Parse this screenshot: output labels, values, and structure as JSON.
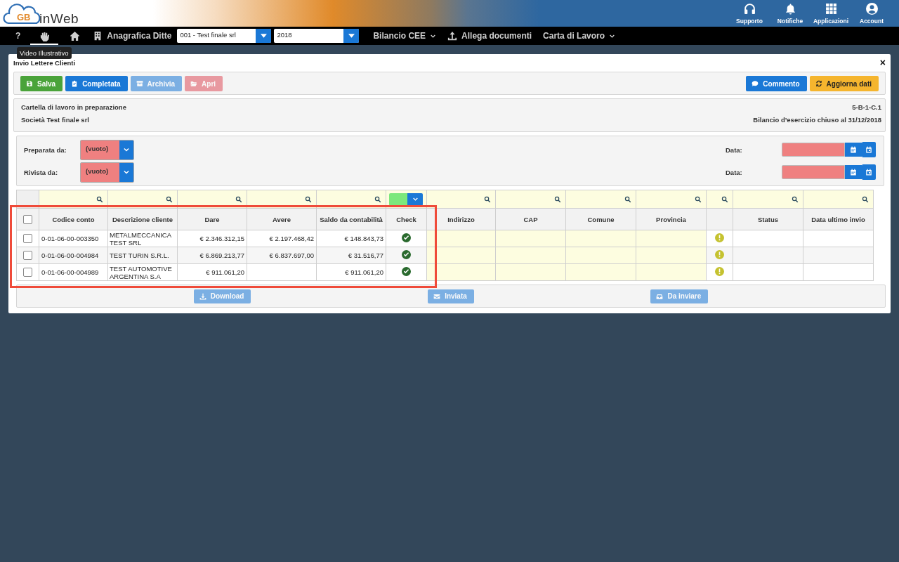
{
  "header": {
    "logo_mark": "GB",
    "logo_text": "inWeb",
    "actions": [
      {
        "kind": "support",
        "label": "Supporto"
      },
      {
        "kind": "notifications",
        "label": "Notifiche"
      },
      {
        "kind": "apps",
        "label": "Applicazioni"
      },
      {
        "kind": "account",
        "label": "Account"
      }
    ]
  },
  "nav": [
    {
      "kind": "help",
      "label": "?",
      "selected": false
    },
    {
      "kind": "video",
      "selected": true
    },
    {
      "kind": "home",
      "selected": false
    },
    {
      "kind": "company",
      "label": "Anagrafica Ditte",
      "selected": false
    },
    {
      "kind": "select",
      "value": "001 - Test finale srl"
    },
    {
      "kind": "select-small",
      "value": "2018"
    },
    {
      "kind": "menu",
      "label": "Bilancio CEE",
      "selected": false
    },
    {
      "kind": "upload",
      "label": "Allega documenti",
      "selected": false
    },
    {
      "kind": "menu",
      "label": "Carta di Lavoro",
      "selected": false
    }
  ],
  "tooltip": {
    "text": "Video Illustrativo"
  },
  "panel": {
    "title": "Invio Lettere Clienti",
    "close": "×"
  },
  "toolbar": {
    "left": [
      {
        "kind": "save",
        "label": "Salva",
        "disabled": false
      },
      {
        "kind": "complete",
        "label": "Completata",
        "disabled": false
      },
      {
        "kind": "archive",
        "label": "Archivia",
        "disabled": true
      },
      {
        "kind": "open",
        "label": "Apri",
        "disabled": true
      }
    ],
    "right": [
      {
        "kind": "comment",
        "label": "Commento",
        "disabled": false
      },
      {
        "kind": "refresh",
        "label": "Aggiorna dati",
        "disabled": false
      }
    ]
  },
  "info": {
    "left": [
      "Cartella di lavoro in preparazione",
      "Società Test finale srl"
    ],
    "right": [
      "5-B-1-C.1",
      "Bilancio d’esercizio chiuso al 31/12/2018"
    ]
  },
  "reviews": [
    {
      "label": "Preparata da:",
      "value": "(vuoto)",
      "date_label": "Data:"
    },
    {
      "label": "Rivista da:",
      "value": "(vuoto)",
      "date_label": "Data:"
    }
  ],
  "table": {
    "columns": [
      {
        "kind": "checkbox",
        "checked": false
      },
      {
        "label": "Codice conto",
        "filter": {
          "kind": "search"
        }
      },
      {
        "label": "Descrizione cliente",
        "filter": {
          "kind": "search"
        }
      },
      {
        "label": "Dare",
        "filter": {
          "kind": "search"
        }
      },
      {
        "label": "Avere",
        "filter": {
          "kind": "search"
        }
      },
      {
        "label": "Saldo da contabilità",
        "filter": {
          "kind": "search"
        }
      },
      {
        "label": "Check",
        "filter": {
          "kind": "status"
        }
      },
      {
        "label": "Indirizzo",
        "filter": {
          "kind": "search"
        }
      },
      {
        "label": "CAP",
        "filter": {
          "kind": "search"
        }
      },
      {
        "label": "Comune",
        "filter": {
          "kind": "search"
        }
      },
      {
        "label": "Provincia",
        "filter": {
          "kind": "search"
        }
      },
      {
        "filter": {
          "kind": "search"
        }
      },
      {
        "label": "Status",
        "filter": {
          "kind": "search"
        }
      },
      {
        "label": "Data ultimo invio",
        "filter": {
          "kind": "search"
        }
      }
    ],
    "rows": [
      {
        "selected": false,
        "code": "0-01-06-00-003350",
        "description": "METALMECCANICA TEST SRL",
        "dare": "€ 2.346.312,15",
        "avere": "€ 2.197.468,42",
        "saldo": "€ 148.843,73",
        "check_ok": true,
        "warning": true
      },
      {
        "selected": false,
        "code": "0-01-06-00-004984",
        "description": "TEST TURIN S.R.L.",
        "dare": "€ 6.869.213,77",
        "avere": "€ 6.837.697,00",
        "saldo": "€ 31.516,77",
        "check_ok": true,
        "warning": true
      },
      {
        "selected": false,
        "code": "0-01-06-00-004989",
        "description": "TEST AUTOMOTIVE ARGENTINA S.A",
        "dare": "€ 911.061,20",
        "saldo": "€ 911.061,20",
        "check_ok": true,
        "warning": true
      }
    ]
  },
  "footer_buttons": [
    {
      "kind": "download",
      "label": "Download",
      "disabled": true
    },
    {
      "kind": "mail",
      "label": "Inviata",
      "disabled": true
    },
    {
      "kind": "inbox",
      "label": "Da inviare",
      "disabled": true
    }
  ]
}
